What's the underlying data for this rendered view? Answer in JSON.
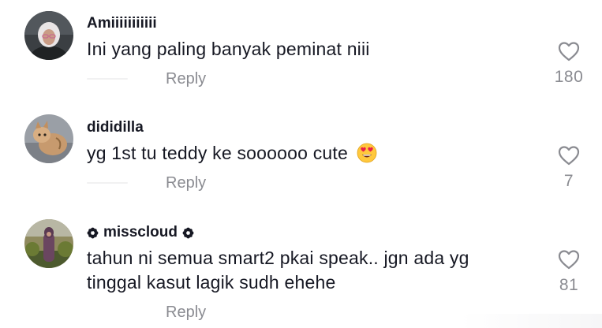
{
  "comments": [
    {
      "username": "Amiiiiiiiiiii",
      "text": "Ini yang paling banyak peminat niii",
      "reply_label": "Reply",
      "likes": "180",
      "avatar_icon": "user-avatar-woman-hijab",
      "badges": false
    },
    {
      "username": "dididilla",
      "text": "yg 1st tu teddy ke soooooo cute",
      "emoji": "heart-eyes-emoji",
      "reply_label": "Reply",
      "likes": "7",
      "avatar_icon": "user-avatar-cat",
      "badges": false
    },
    {
      "username": "misscloud",
      "text_lines": [
        "tahun ni semua smart2 pkai speak.. jgn ada yg",
        "tinggal kasut lagik sudh ehehe"
      ],
      "reply_label": "Reply",
      "likes": "81",
      "avatar_icon": "user-avatar-person-outdoors",
      "badges": true,
      "badge_icon": "flower-badge-icon"
    }
  ],
  "colors": {
    "primary_text": "#161823",
    "secondary_text": "#8a8b91",
    "heart_outline": "#8a8b91",
    "background": "#ffffff"
  }
}
